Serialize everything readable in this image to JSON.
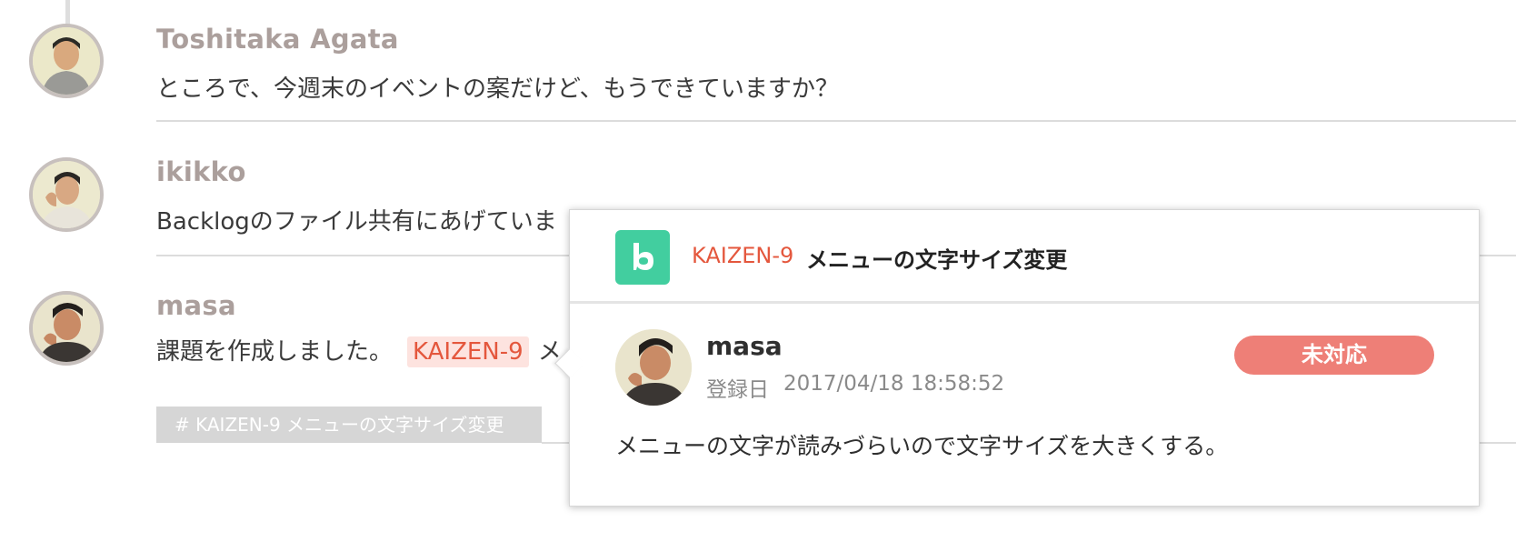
{
  "messages": [
    {
      "author": "Toshitaka Agata",
      "text": "ところで、今週末のイベントの案だけど、もうできていますか？"
    },
    {
      "author": "ikikko",
      "text": "Backlogのファイル共有にあげていま"
    },
    {
      "author": "masa",
      "text_before": "課題を作成しました。",
      "issue_key": "KAIZEN-9",
      "text_after": "メ",
      "issue_tag": "# KAIZEN-9 メニューの文字サイズ変更"
    }
  ],
  "popup": {
    "issue_key": "KAIZEN-9",
    "summary": "メニューの文字サイズ変更",
    "author": "masa",
    "date_label": "登録日",
    "date_value": "2017/04/18 18:58:52",
    "status": "未対応",
    "description": "メニューの文字が読みづらいので文字サイズを大きくする。"
  },
  "colors": {
    "issue_key": "#e4573d",
    "status_badge": "#ee7f77",
    "project_icon": "#42ce9f",
    "author_name": "#ab9f9c"
  },
  "icons": {
    "project": "backlog-b-icon"
  }
}
